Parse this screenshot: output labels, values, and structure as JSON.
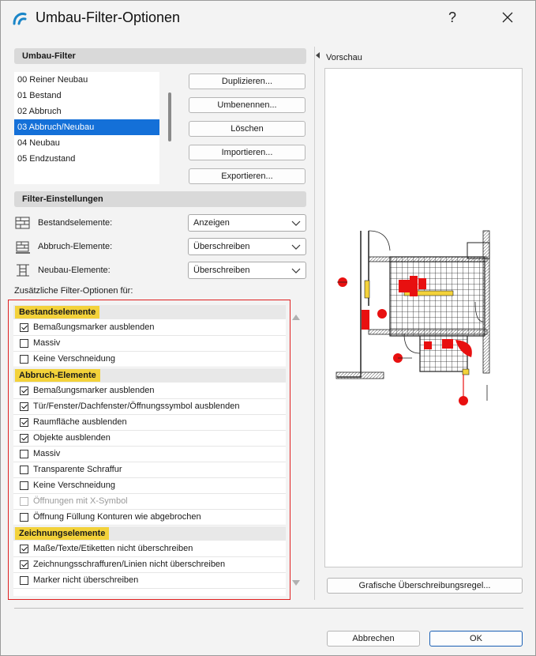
{
  "window": {
    "title": "Umbau-Filter-Optionen",
    "help_label": "?"
  },
  "umbau_filter": {
    "header": "Umbau-Filter",
    "items": [
      {
        "label": "00 Reiner Neubau",
        "selected": false
      },
      {
        "label": "01 Bestand",
        "selected": false
      },
      {
        "label": "02 Abbruch",
        "selected": false
      },
      {
        "label": "03 Abbruch/Neubau",
        "selected": true
      },
      {
        "label": "04 Neubau",
        "selected": false
      },
      {
        "label": "05 Endzustand",
        "selected": false
      }
    ],
    "buttons": {
      "duplicate": "Duplizieren...",
      "rename": "Umbenennen...",
      "delete": "Löschen",
      "import": "Importieren...",
      "export": "Exportieren..."
    }
  },
  "filter_settings": {
    "header": "Filter-Einstellungen",
    "rows": [
      {
        "label": "Bestandselemente:",
        "value": "Anzeigen",
        "icon": "brick-wall-icon"
      },
      {
        "label": "Abbruch-Elemente:",
        "value": "Überschreiben",
        "icon": "demolish-icon"
      },
      {
        "label": "Neubau-Elemente:",
        "value": "Überschreiben",
        "icon": "new-construction-icon"
      }
    ]
  },
  "additional_options": {
    "title": "Zusätzliche Filter-Optionen für:",
    "groups": [
      {
        "name": "Bestandselemente",
        "options": [
          {
            "label": "Bemaßungsmarker ausblenden",
            "checked": true,
            "disabled": false
          },
          {
            "label": "Massiv",
            "checked": false,
            "disabled": false
          },
          {
            "label": "Keine Verschneidung",
            "checked": false,
            "disabled": false
          }
        ]
      },
      {
        "name": "Abbruch-Elemente",
        "options": [
          {
            "label": "Bemaßungsmarker ausblenden",
            "checked": true,
            "disabled": false
          },
          {
            "label": "Tür/Fenster/Dachfenster/Öffnungssymbol ausblenden",
            "checked": true,
            "disabled": false
          },
          {
            "label": "Raumfläche ausblenden",
            "checked": true,
            "disabled": false
          },
          {
            "label": "Objekte ausblenden",
            "checked": true,
            "disabled": false
          },
          {
            "label": "Massiv",
            "checked": false,
            "disabled": false
          },
          {
            "label": "Transparente Schraffur",
            "checked": false,
            "disabled": false
          },
          {
            "label": "Keine Verschneidung",
            "checked": false,
            "disabled": false
          },
          {
            "label": "Öffnungen mit X-Symbol",
            "checked": false,
            "disabled": true
          },
          {
            "label": "Öffnung Füllung Konturen wie abgebrochen",
            "checked": false,
            "disabled": false
          }
        ]
      },
      {
        "name": "Zeichnungselemente",
        "options": [
          {
            "label": "Maße/Texte/Etiketten nicht überschreiben",
            "checked": true,
            "disabled": false
          },
          {
            "label": "Zeichnungsschraffuren/Linien nicht überschreiben",
            "checked": true,
            "disabled": false
          },
          {
            "label": "Marker nicht überschreiben",
            "checked": false,
            "disabled": false
          }
        ]
      }
    ]
  },
  "preview": {
    "label": "Vorschau",
    "override_button": "Grafische Überschreibungsregel..."
  },
  "footer": {
    "cancel": "Abbrechen",
    "ok": "OK"
  },
  "colors": {
    "accent": "#1470d8",
    "highlight": "#f3d23a",
    "frame": "#e02020",
    "demolish": "#e81010"
  }
}
